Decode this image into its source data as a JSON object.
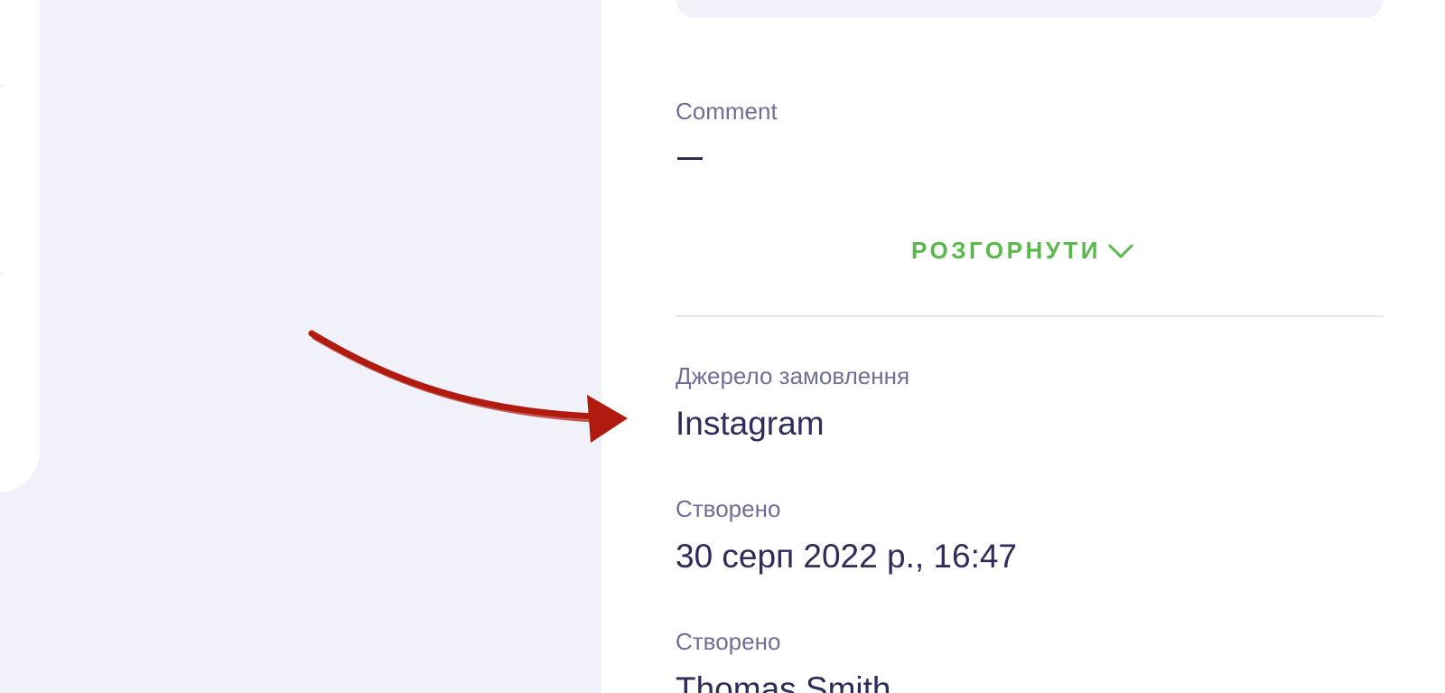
{
  "details": {
    "comment_label": "Comment",
    "comment_value": "—",
    "expand_label": "РОЗГОРНУТИ",
    "source_label": "Джерело замовлення",
    "source_value": "Instagram",
    "created_label": "Створено",
    "created_value": "30 серп 2022 р., 16:47",
    "creator_label": "Створено",
    "creator_value": "Thomas Smith"
  },
  "icons": {
    "expand": "chevron-down-icon",
    "annotation": "red-arrow-icon"
  },
  "colors": {
    "accent_green": "#58b84a",
    "label_gray": "#6f6f95",
    "value_dark": "#2d2c5a",
    "annotation_red": "#b01a0f",
    "background": "#f1f1f9"
  }
}
